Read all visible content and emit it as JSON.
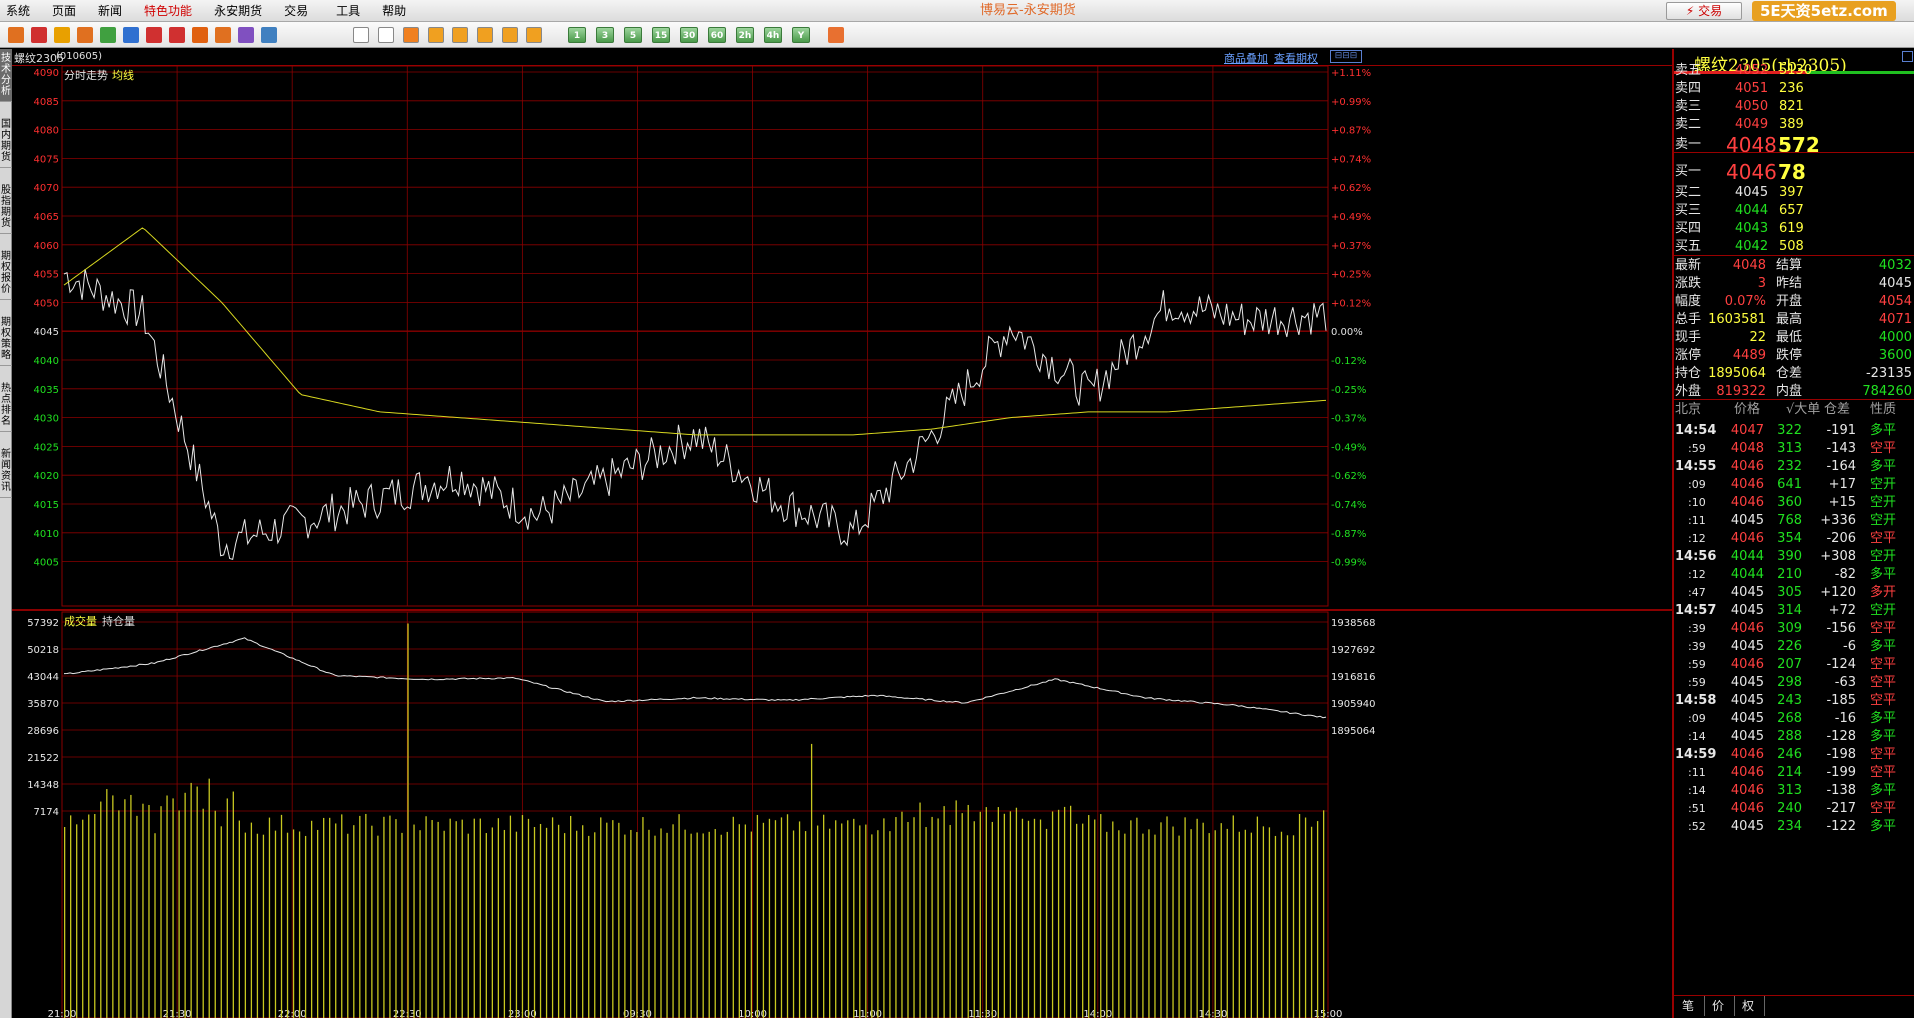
{
  "menu": {
    "items": [
      "系统",
      "页面",
      "新闻",
      "特色功能",
      "永安期货",
      "交易",
      "工具",
      "帮助"
    ],
    "highlight_index": 3,
    "app_title": "博易云-永安期货",
    "trade_button": "⚡ 交易",
    "watermark": "5E天资5etz.com"
  },
  "toolbar": {
    "period_buttons": [
      "1",
      "3",
      "5",
      "15",
      "30",
      "60",
      "2h",
      "4h",
      "Y"
    ]
  },
  "sidebar": {
    "tabs": [
      "技术分析",
      "国内期货",
      "股指期货",
      "期权报价",
      "期权策略",
      "热点排名",
      "新闻资讯"
    ],
    "active_index": 0
  },
  "header": {
    "symbol_label": "螺纹2305",
    "symbol_code": "(010605)",
    "link_overlay": "商品叠加",
    "link_options": "查看期权"
  },
  "chart": {
    "legend_price": "分时走势",
    "legend_avg": "均线",
    "legend_volume": "成交量",
    "legend_oi": "持仓量",
    "price_ticks": [
      "4090",
      "4085",
      "4080",
      "4075",
      "4070",
      "4065",
      "4060",
      "4055",
      "4050",
      "4045",
      "4040",
      "4035",
      "4030",
      "4025",
      "4020",
      "4015",
      "4010",
      "4005"
    ],
    "pct_ticks": [
      "+1.11%",
      "+0.99%",
      "+0.87%",
      "+0.74%",
      "+0.62%",
      "+0.49%",
      "+0.37%",
      "+0.25%",
      "+0.12%",
      "0.00%",
      "-0.12%",
      "-0.25%",
      "-0.37%",
      "-0.49%",
      "-0.62%",
      "-0.74%",
      "-0.87%",
      "-0.99%"
    ],
    "vol_ticks": [
      "57392",
      "50218",
      "43044",
      "35870",
      "28696",
      "21522",
      "14348",
      "7174"
    ],
    "oi_ticks": [
      "1938568",
      "1927692",
      "1916816",
      "1905940",
      "1895064"
    ],
    "time_ticks": [
      "21:00",
      "21:30",
      "22:00",
      "22:30",
      "23:00",
      "09:30",
      "10:00",
      "11:00",
      "11:30",
      "14:00",
      "14:30",
      "15:00"
    ],
    "colors": {
      "price": "#e8e8e8",
      "avg": "#d8d820",
      "volume": "#c8c820",
      "oi": "#e8e8e8",
      "grid": "#8a0000",
      "up": "#ff3030",
      "down": "#20e020"
    }
  },
  "chart_data": {
    "type": "line",
    "prev_settle": 4045,
    "ylim": [
      4002,
      4091
    ],
    "x": [
      "21:00",
      "21:30",
      "22:00",
      "22:30",
      "23:00",
      "09:30",
      "10:00",
      "10:30",
      "11:00",
      "11:30",
      "14:00",
      "14:30",
      "15:00"
    ],
    "series": [
      {
        "name": "分时走势",
        "values": [
          4055,
          4048,
          4008,
          4012,
          4016,
          4020,
          4013,
          4020,
          4027,
          4016,
          4010,
          4027,
          4046,
          4034,
          4050,
          4047,
          4048
        ]
      },
      {
        "name": "均线",
        "values": [
          4053,
          4063,
          4050,
          4034,
          4031,
          4030,
          4029,
          4028,
          4027,
          4027,
          4027,
          4028,
          4030,
          4031,
          4031,
          4032,
          4033
        ]
      }
    ],
    "volume": {
      "name": "成交量",
      "ylim": [
        0,
        57392
      ]
    },
    "open_interest": {
      "name": "持仓量",
      "ylim": [
        1895064,
        1938568
      ],
      "values": [
        1917500,
        1922000,
        1932000,
        1917000,
        1915500,
        1916000,
        1906500,
        1908000,
        1907000,
        1909000,
        1906000,
        1915500,
        1908000,
        1905000,
        1900000
      ]
    }
  },
  "quote": {
    "title": "螺纹2305(rb2305)",
    "asks": [
      {
        "label": "卖五",
        "price": "4052",
        "vol": "5130"
      },
      {
        "label": "卖四",
        "price": "4051",
        "vol": "236"
      },
      {
        "label": "卖三",
        "price": "4050",
        "vol": "821"
      },
      {
        "label": "卖二",
        "price": "4049",
        "vol": "389"
      },
      {
        "label": "卖一",
        "price": "4048",
        "vol": "572"
      }
    ],
    "bids": [
      {
        "label": "买一",
        "price": "4046",
        "vol": "78"
      },
      {
        "label": "买二",
        "price": "4045",
        "vol": "397"
      },
      {
        "label": "买三",
        "price": "4044",
        "vol": "657"
      },
      {
        "label": "买四",
        "price": "4043",
        "vol": "619"
      },
      {
        "label": "买五",
        "price": "4042",
        "vol": "508"
      }
    ],
    "stats": [
      [
        "最新",
        "4048",
        "r",
        "结算",
        "4032",
        "g"
      ],
      [
        "涨跌",
        "3",
        "r",
        "昨结",
        "4045",
        "w"
      ],
      [
        "幅度",
        "0.07%",
        "r",
        "开盘",
        "4054",
        "r"
      ],
      [
        "总手",
        "1603581",
        "y",
        "最高",
        "4071",
        "r"
      ],
      [
        "现手",
        "22",
        "y",
        "最低",
        "4000",
        "g"
      ],
      [
        "涨停",
        "4489",
        "r",
        "跌停",
        "3600",
        "g"
      ],
      [
        "持仓",
        "1895064",
        "y",
        "仓差",
        "-23135",
        "w"
      ],
      [
        "外盘",
        "819322",
        "r",
        "内盘",
        "784260",
        "g"
      ]
    ],
    "tick_header": [
      "北京",
      "价格",
      "√大单",
      "仓差",
      "性质"
    ],
    "ticks": [
      [
        "14:54",
        "4047",
        "r",
        "322",
        "-191",
        "多平",
        "g"
      ],
      [
        ":59",
        "4048",
        "r",
        "313",
        "-143",
        "空平",
        "r"
      ],
      [
        "14:55",
        "4046",
        "r",
        "232",
        "-164",
        "多平",
        "g"
      ],
      [
        ":09",
        "4046",
        "r",
        "641",
        "+17",
        "空开",
        "g"
      ],
      [
        ":10",
        "4046",
        "r",
        "360",
        "+15",
        "空开",
        "g"
      ],
      [
        ":11",
        "4045",
        "w",
        "768",
        "+336",
        "空开",
        "g"
      ],
      [
        ":12",
        "4046",
        "r",
        "354",
        "-206",
        "空平",
        "r"
      ],
      [
        "14:56",
        "4044",
        "g",
        "390",
        "+308",
        "空开",
        "g"
      ],
      [
        ":12",
        "4044",
        "g",
        "210",
        "-82",
        "多平",
        "g"
      ],
      [
        ":47",
        "4045",
        "w",
        "305",
        "+120",
        "多开",
        "r"
      ],
      [
        "14:57",
        "4045",
        "w",
        "314",
        "+72",
        "空开",
        "g"
      ],
      [
        ":39",
        "4046",
        "r",
        "309",
        "-156",
        "空平",
        "r"
      ],
      [
        ":39",
        "4045",
        "w",
        "226",
        "-6",
        "多平",
        "g"
      ],
      [
        ":59",
        "4046",
        "r",
        "207",
        "-124",
        "空平",
        "r"
      ],
      [
        ":59",
        "4045",
        "w",
        "298",
        "-63",
        "空平",
        "r"
      ],
      [
        "14:58",
        "4045",
        "w",
        "243",
        "-185",
        "空平",
        "r"
      ],
      [
        ":09",
        "4045",
        "w",
        "268",
        "-16",
        "多平",
        "g"
      ],
      [
        ":14",
        "4045",
        "w",
        "288",
        "-128",
        "多平",
        "g"
      ],
      [
        "14:59",
        "4046",
        "r",
        "246",
        "-198",
        "空平",
        "r"
      ],
      [
        ":11",
        "4046",
        "r",
        "214",
        "-199",
        "空平",
        "r"
      ],
      [
        ":14",
        "4046",
        "r",
        "313",
        "-138",
        "多平",
        "g"
      ],
      [
        ":51",
        "4046",
        "r",
        "240",
        "-217",
        "空平",
        "r"
      ],
      [
        ":52",
        "4045",
        "w",
        "234",
        "-122",
        "多平",
        "g"
      ]
    ],
    "bottom_tabs": [
      "笔",
      "价",
      "权"
    ]
  }
}
